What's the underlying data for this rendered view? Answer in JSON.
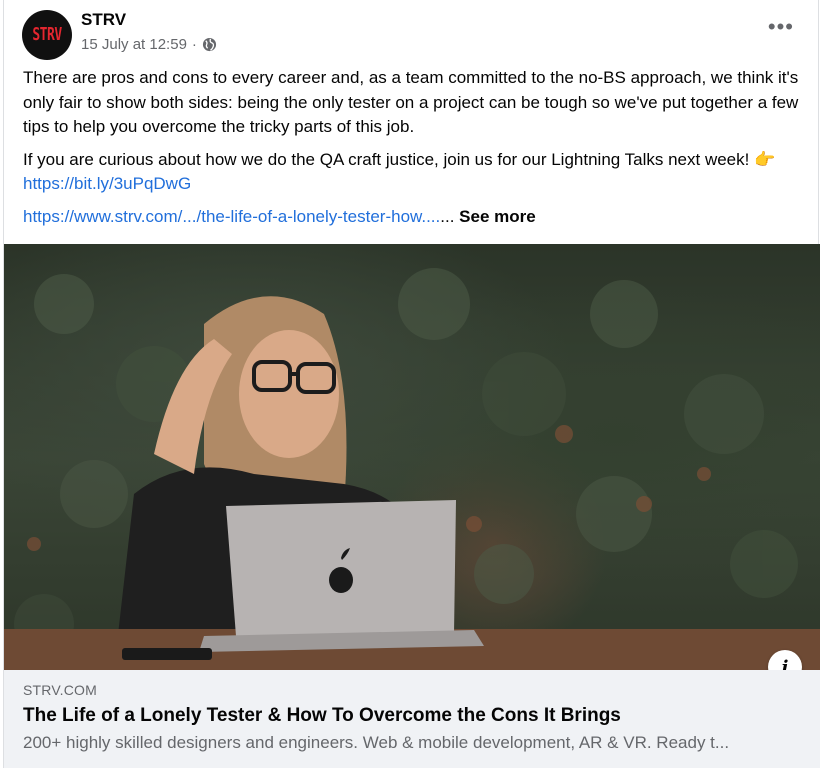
{
  "post": {
    "author": "STRV",
    "avatar_text": "STRV",
    "timestamp": "15 July at 12:59",
    "separator": "·",
    "more_label": "•••",
    "paragraph1": "There are pros and cons to every career and, as a team committed to the no-BS approach, we think it's only fair to show both sides: being the only tester on a project can be tough so we've put together a few tips to help you overcome the tricky parts of this job.",
    "paragraph2_text": "If you are curious about how we do the QA craft justice, join us for our Lightning Talks next week! ",
    "paragraph2_emoji": "👉",
    "paragraph2_link": "https://bit.ly/3uPqDwG",
    "long_link": "https://www.strv.com/.../the-life-of-a-lonely-tester-how....",
    "ellipsis": "... ",
    "see_more": "See more"
  },
  "image": {
    "info_label": "i"
  },
  "link_preview": {
    "domain": "STRV.COM",
    "title": "The Life of a Lonely Tester & How To Overcome the Cons It Brings",
    "description": "200+ highly skilled designers and engineers. Web & mobile development, AR & VR. Ready t..."
  },
  "colors": {
    "link": "#216fdb",
    "secondary_text": "#65676b",
    "preview_bg": "#f0f2f5",
    "brand_red": "#e3262f"
  },
  "icons": {
    "privacy": "globe-icon",
    "menu": "more-options-icon",
    "info": "info-icon"
  }
}
